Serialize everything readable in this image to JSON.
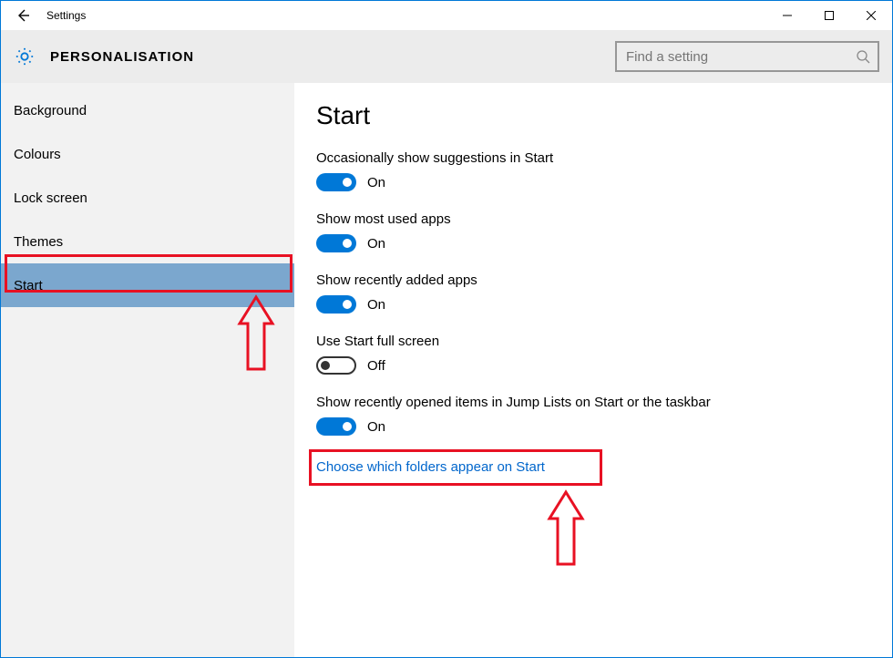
{
  "window": {
    "title": "Settings"
  },
  "header": {
    "section": "PERSONALISATION",
    "search_placeholder": "Find a setting"
  },
  "sidebar": {
    "items": [
      {
        "label": "Background",
        "selected": false
      },
      {
        "label": "Colours",
        "selected": false
      },
      {
        "label": "Lock screen",
        "selected": false
      },
      {
        "label": "Themes",
        "selected": false
      },
      {
        "label": "Start",
        "selected": true
      }
    ]
  },
  "content": {
    "page_title": "Start",
    "settings": [
      {
        "label": "Occasionally show suggestions in Start",
        "on": true,
        "state": "On"
      },
      {
        "label": "Show most used apps",
        "on": true,
        "state": "On"
      },
      {
        "label": "Show recently added apps",
        "on": true,
        "state": "On"
      },
      {
        "label": "Use Start full screen",
        "on": false,
        "state": "Off"
      },
      {
        "label": "Show recently opened items in Jump Lists on Start or the taskbar",
        "on": true,
        "state": "On"
      }
    ],
    "link": "Choose which folders appear on Start"
  },
  "annotations": {
    "highlight_sidebar_item": "Start",
    "highlight_link": "Choose which folders appear on Start"
  }
}
